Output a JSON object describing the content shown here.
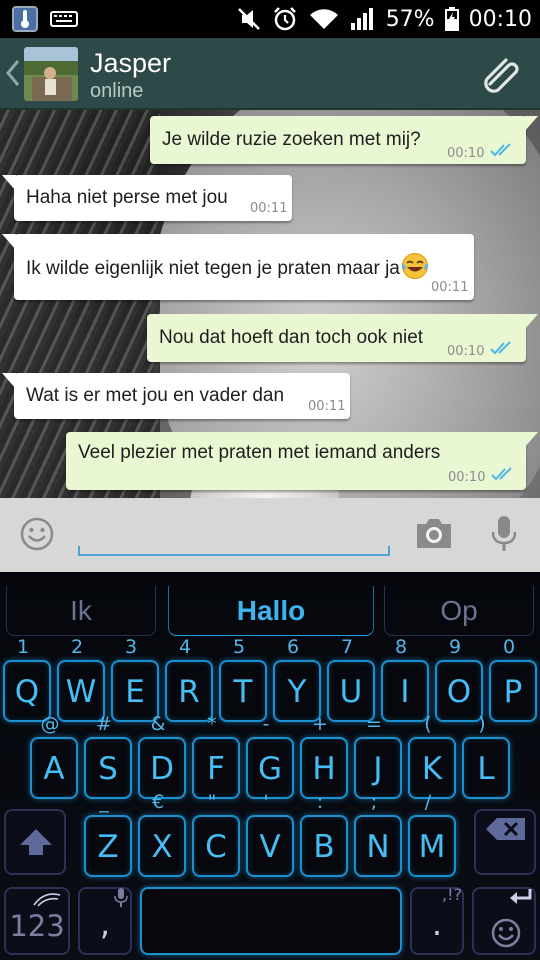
{
  "status_bar": {
    "battery_percent": "57%",
    "time": "00:10",
    "icons": [
      "thermometer-notification-icon",
      "keyboard-notification-icon",
      "mute-icon",
      "alarm-icon",
      "wifi-icon",
      "signal-icon",
      "battery-icon"
    ]
  },
  "header": {
    "contact_name": "Jasper",
    "contact_status": "online",
    "icons": [
      "back-chevron-icon",
      "contact-avatar",
      "attach-paperclip-icon"
    ]
  },
  "messages": [
    {
      "direction": "outgoing",
      "text": "Je wilde ruzie zoeken met mij?",
      "time": "00:10",
      "read": true
    },
    {
      "direction": "incoming",
      "text": "Haha niet perse met jou",
      "time": "00:11"
    },
    {
      "direction": "incoming",
      "text": "Ik wilde eigenlijk niet tegen je praten maar ja",
      "emoji": "tears-of-joy-emoji",
      "time": "00:11"
    },
    {
      "direction": "outgoing",
      "text": "Nou dat hoeft dan toch ook niet",
      "time": "00:10",
      "read": true
    },
    {
      "direction": "incoming",
      "text": "Wat is er met jou en vader dan",
      "time": "00:11"
    },
    {
      "direction": "outgoing",
      "text": "Veel plezier met praten met iemand anders",
      "time": "00:10",
      "read": true
    }
  ],
  "input_bar": {
    "value": "",
    "icons": [
      "smiley-icon",
      "camera-icon",
      "microphone-icon"
    ]
  },
  "keyboard": {
    "suggestions": [
      "Ik",
      "Hallo",
      "Op"
    ],
    "row1": [
      {
        "l": "Q",
        "a": "1"
      },
      {
        "l": "W",
        "a": "2"
      },
      {
        "l": "E",
        "a": "3"
      },
      {
        "l": "R",
        "a": "4"
      },
      {
        "l": "T",
        "a": "5"
      },
      {
        "l": "Y",
        "a": "6"
      },
      {
        "l": "U",
        "a": "7"
      },
      {
        "l": "I",
        "a": "8"
      },
      {
        "l": "O",
        "a": "9"
      },
      {
        "l": "P",
        "a": "0"
      }
    ],
    "row2": [
      {
        "l": "A",
        "a": "@"
      },
      {
        "l": "S",
        "a": "#"
      },
      {
        "l": "D",
        "a": "&"
      },
      {
        "l": "F",
        "a": "*"
      },
      {
        "l": "G",
        "a": "-"
      },
      {
        "l": "H",
        "a": "+"
      },
      {
        "l": "J",
        "a": "="
      },
      {
        "l": "K",
        "a": "("
      },
      {
        "l": "L",
        "a": ")"
      }
    ],
    "row3": [
      {
        "l": "Z",
        "a": "_"
      },
      {
        "l": "X",
        "a": "€"
      },
      {
        "l": "C",
        "a": "\""
      },
      {
        "l": "V",
        "a": "'"
      },
      {
        "l": "B",
        "a": ":"
      },
      {
        "l": "N",
        "a": ";"
      },
      {
        "l": "M",
        "a": "/"
      }
    ],
    "bottom": {
      "numbers_label": "123",
      "comma": ",",
      "period": ".",
      "period_alt": ",!?"
    },
    "icons": [
      "shift-icon",
      "backspace-icon",
      "swype-logo-icon",
      "mic-small-icon",
      "enter-icon",
      "keyboard-smiley-icon"
    ]
  },
  "colors": {
    "header_bg": "#2e4a48",
    "outgoing_bubble": "#e9f8d3",
    "read_ticks": "#4fb4e6",
    "keyboard_accent": "#1b8fcf",
    "key_label": "#45bdf5"
  }
}
